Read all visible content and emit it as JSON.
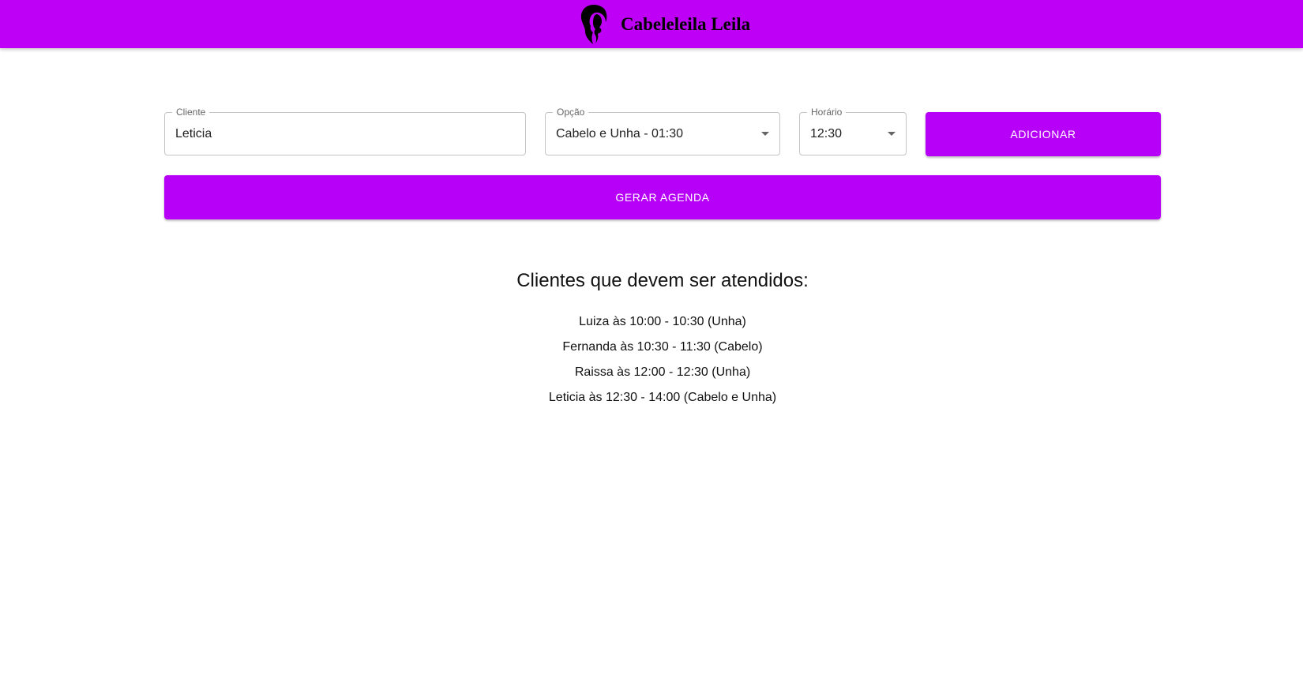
{
  "header": {
    "brand_name": "Cabeleleila Leila",
    "background_color": "#bf00f7",
    "logo_icon": "woman-silhouette-icon"
  },
  "form": {
    "cliente": {
      "label": "Cliente",
      "value": "Leticia"
    },
    "opcao": {
      "label": "Opção",
      "value": "Cabelo e Unha - 01:30"
    },
    "horario": {
      "label": "Horário",
      "value": "12:30"
    },
    "add_button": "ADICIONAR",
    "generate_button": "GERAR AGENDA",
    "button_color": "#b700f7"
  },
  "schedule": {
    "title": "Clientes que devem ser atendidos:",
    "items": [
      "Luiza às 10:00 - 10:30 (Unha)",
      "Fernanda às 10:30 - 11:30 (Cabelo)",
      "Raissa às 12:00 - 12:30 (Unha)",
      "Leticia às 12:30 - 14:00 (Cabelo e Unha)"
    ]
  }
}
